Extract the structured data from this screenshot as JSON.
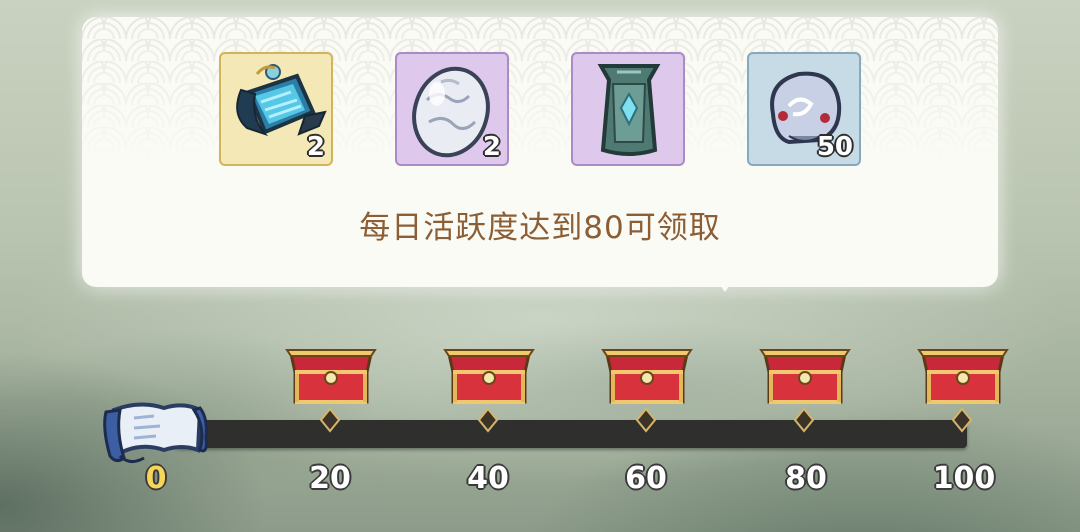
{
  "tooltip": {
    "rewards": [
      {
        "name": "blue-scroll",
        "quantity": "2",
        "frame": "gold"
      },
      {
        "name": "silver-egg",
        "quantity": "2",
        "frame": "purple"
      },
      {
        "name": "jade-tablet",
        "quantity": "",
        "frame": "purple"
      },
      {
        "name": "spirit-ore",
        "quantity": "50",
        "frame": "blue"
      }
    ],
    "description": "每日活跃度达到80可领取"
  },
  "progress": {
    "current_value": "0",
    "milestones": [
      "20",
      "40",
      "60",
      "80",
      "100"
    ],
    "selected_milestone": "80"
  },
  "colors": {
    "description_text": "#8b5e35",
    "current_value": "#f6d65a",
    "track": "#2f2f2d",
    "chest_red": "#d8333d",
    "chest_gold": "#e3b75a"
  }
}
